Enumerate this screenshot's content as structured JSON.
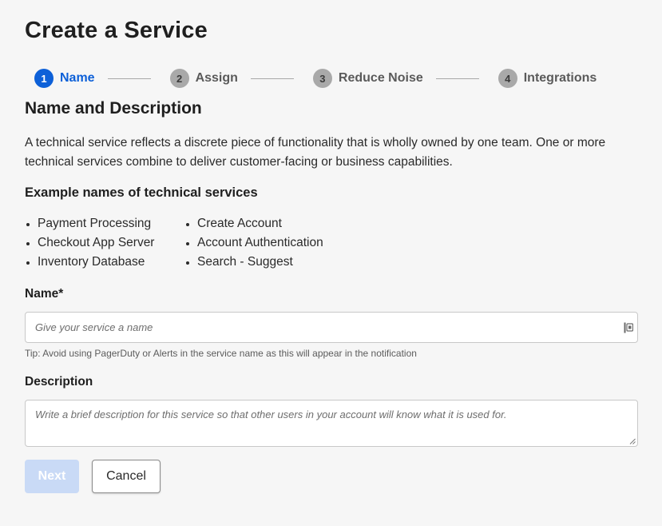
{
  "page": {
    "title": "Create a Service"
  },
  "stepper": {
    "steps": [
      {
        "num": "1",
        "label": "Name",
        "active": true
      },
      {
        "num": "2",
        "label": "Assign",
        "active": false
      },
      {
        "num": "3",
        "label": "Reduce Noise",
        "active": false
      },
      {
        "num": "4",
        "label": "Integrations",
        "active": false
      }
    ]
  },
  "section": {
    "title": "Name and Description",
    "intro": "A technical service reflects a discrete piece of functionality that is wholly owned by one team. One or more technical services combine to deliver customer-facing or business capabilities."
  },
  "examples": {
    "title": "Example names of technical services",
    "col1": [
      "Payment Processing",
      "Checkout App Server",
      "Inventory Database"
    ],
    "col2": [
      "Create Account",
      "Account Authentication",
      "Search - Suggest"
    ]
  },
  "form": {
    "name_label": "Name*",
    "name_placeholder": "Give your service a name",
    "name_value": "",
    "tip": "Tip: Avoid using PagerDuty or Alerts in the service name as this will appear in the notification",
    "description_label": "Description",
    "description_placeholder": "Write a brief description for this service so that other users in your account will know what it is used for.",
    "description_value": ""
  },
  "buttons": {
    "next": "Next",
    "cancel": "Cancel"
  },
  "colors": {
    "accent": "#0d60d8",
    "inactive_step": "#a9a9a9",
    "next_disabled": "#c9daf6"
  }
}
